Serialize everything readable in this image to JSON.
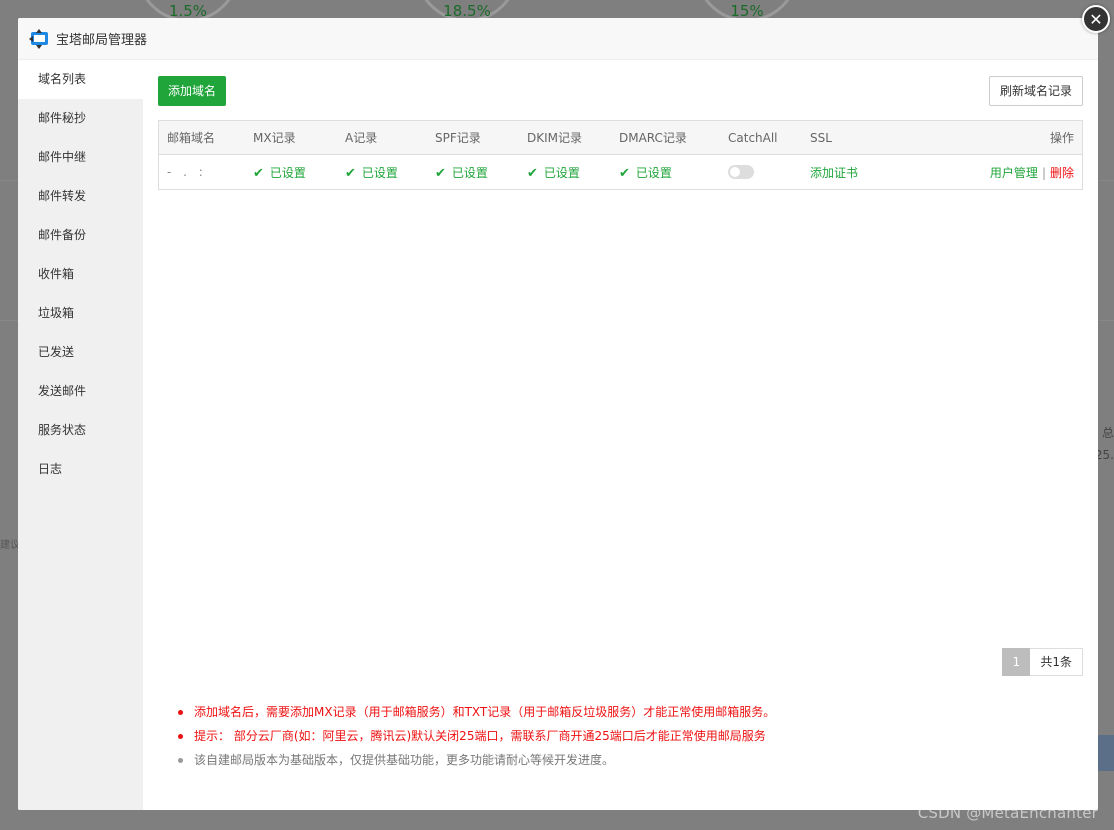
{
  "background": {
    "gauges": [
      "1.5%",
      "18.5%",
      "15%"
    ],
    "side_text": "建议",
    "right_text_1": "总",
    "right_text_2": "25."
  },
  "watermark": "CSDN @MetaEnchanter",
  "modal": {
    "title": "宝塔邮局管理器",
    "close_icon": "close-icon",
    "logo_icon": "bt-mail-logo-icon"
  },
  "sidebar": {
    "items": [
      {
        "label": "域名列表",
        "active": true
      },
      {
        "label": "邮件秘抄"
      },
      {
        "label": "邮件中继"
      },
      {
        "label": "邮件转发"
      },
      {
        "label": "邮件备份"
      },
      {
        "label": "收件箱"
      },
      {
        "label": "垃圾箱"
      },
      {
        "label": "已发送"
      },
      {
        "label": "发送邮件"
      },
      {
        "label": "服务状态"
      },
      {
        "label": "日志"
      }
    ]
  },
  "toolbar": {
    "add_domain": "添加域名",
    "refresh_records": "刷新域名记录"
  },
  "table": {
    "headers": [
      "邮箱域名",
      "MX记录",
      "A记录",
      "SPF记录",
      "DKIM记录",
      "DMARC记录",
      "CatchAll",
      "SSL",
      "操作"
    ],
    "rows": [
      {
        "domain": "- . :",
        "mx": "已设置",
        "a": "已设置",
        "spf": "已设置",
        "dkim": "已设置",
        "dmarc": "已设置",
        "catchall": false,
        "ssl": "添加证书",
        "user_manage": "用户管理",
        "sep": "|",
        "delete": "删除"
      }
    ]
  },
  "pagination": {
    "current": "1",
    "total": "共1条"
  },
  "tips": [
    "添加域名后，需要添加MX记录（用于邮箱服务）和TXT记录（用于邮箱反垃圾服务）才能正常使用邮箱服务。",
    "提示： 部分云厂商(如：阿里云，腾讯云)默认关闭25端口，需联系厂商开通25端口后才能正常使用邮局服务",
    "该自建邮局版本为基础版本，仅提供基础功能，更多功能请耐心等候开发进度。"
  ],
  "colors": {
    "primary": "#20a53a",
    "danger": "#ee1111",
    "sidebar_bg": "#f0f0f0"
  }
}
